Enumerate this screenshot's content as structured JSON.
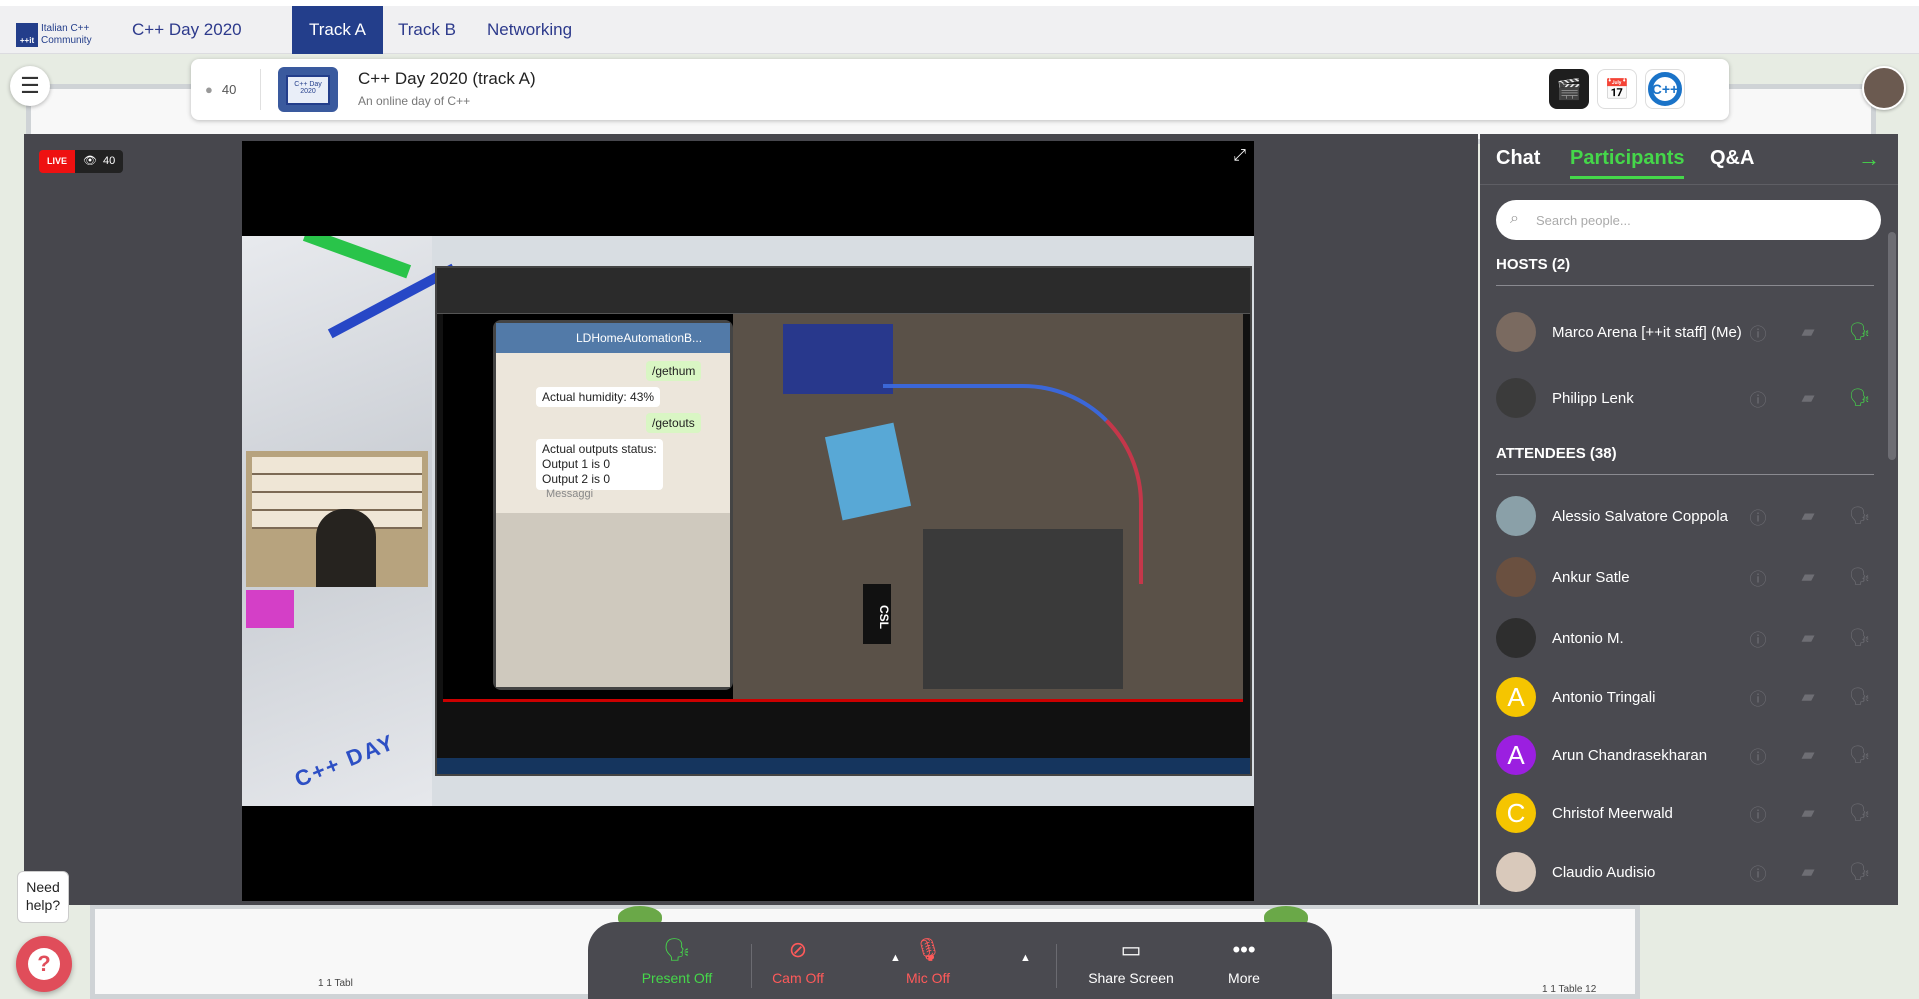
{
  "topnav": {
    "logo_line1": "Italian C++",
    "logo_line2": "Community",
    "logo_mark": "++it",
    "tabs": [
      {
        "label": "C++ Day 2020"
      },
      {
        "label": "Track A"
      },
      {
        "label": "Track B"
      },
      {
        "label": "Networking"
      }
    ]
  },
  "infocard": {
    "attendee_count": "40",
    "thumb_text": "C++ Day 2020",
    "title": "C++ Day 2020 (track A)",
    "subtitle": "An online day of C++",
    "logo_mark": "C++"
  },
  "stage": {
    "live_label": "LIVE",
    "viewer_count": "40"
  },
  "video": {
    "phone_chat_title": "LDHomeAutomationB...",
    "messages": [
      "/gethum",
      "Actual humidity: 43%",
      "/getouts",
      "Actual outputs status:",
      "Output 1 is 0",
      "Output 2 is 0"
    ],
    "input_placeholder": "Messaggi",
    "overlay_text": "C++ DAY",
    "badge_text": "CSL"
  },
  "sidepanel": {
    "tabs": [
      {
        "label": "Chat"
      },
      {
        "label": "Participants"
      },
      {
        "label": "Q&A"
      }
    ],
    "search_placeholder": "Search people...",
    "hosts_heading": "HOSTS (2)",
    "attendees_heading": "ATTENDEES (38)",
    "hosts": [
      {
        "name": "Marco Arena [++it staff] (Me)",
        "avatar_color": "#7a6a60"
      },
      {
        "name": "Philipp Lenk",
        "avatar_color": "#3b3b3b"
      }
    ],
    "attendees": [
      {
        "name": "Alessio Salvatore Coppola",
        "avatar_color": "#8aa0a8",
        "initial": ""
      },
      {
        "name": "Ankur Satle",
        "avatar_color": "#6a5040",
        "initial": ""
      },
      {
        "name": "Antonio M.",
        "avatar_color": "#2e2e2e",
        "initial": ""
      },
      {
        "name": "Antonio Tringali",
        "avatar_color": "#f5c500",
        "initial": "A"
      },
      {
        "name": "Arun Chandrasekharan",
        "avatar_color": "#9b1fe0",
        "initial": "A"
      },
      {
        "name": "Christof Meerwald",
        "avatar_color": "#f5c500",
        "initial": "C"
      },
      {
        "name": "Claudio Audisio",
        "avatar_color": "#d9c9bb",
        "initial": ""
      }
    ],
    "accent": "#45d74a"
  },
  "controls": {
    "present": "Present Off",
    "cam": "Cam Off",
    "mic": "Mic Off",
    "share": "Share Screen",
    "more": "More"
  },
  "venue": {
    "table_label_left": "1 1 Tabl",
    "table_label_right": "1 1 Table 12"
  },
  "help": {
    "bubble_line1": "Need",
    "bubble_line2": "help?"
  }
}
